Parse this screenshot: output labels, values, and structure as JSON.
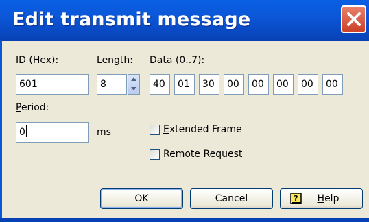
{
  "window": {
    "title": "Edit transmit message"
  },
  "labels": {
    "id": "ID (Hex):",
    "length": "Length:",
    "data": "Data (0..7):",
    "period": "Period:",
    "ms": "ms"
  },
  "fields": {
    "id_value": "601",
    "length_value": "8",
    "data_bytes": [
      "40",
      "01",
      "30",
      "00",
      "00",
      "00",
      "00",
      "00"
    ],
    "period_value": "0"
  },
  "checkboxes": {
    "extended_frame": {
      "label": "Extended Frame",
      "checked": false
    },
    "remote_request": {
      "label": "Remote Request",
      "checked": false
    }
  },
  "buttons": {
    "ok": "OK",
    "cancel": "Cancel",
    "help": "Help"
  },
  "colors": {
    "titlebar": "#0b57d8",
    "close": "#cc4129",
    "dialog": "#ece9d8"
  },
  "icons": {
    "close": "close-icon",
    "help": "help-book-icon",
    "spin_up": "triangle-up-icon",
    "spin_down": "triangle-down-icon"
  }
}
